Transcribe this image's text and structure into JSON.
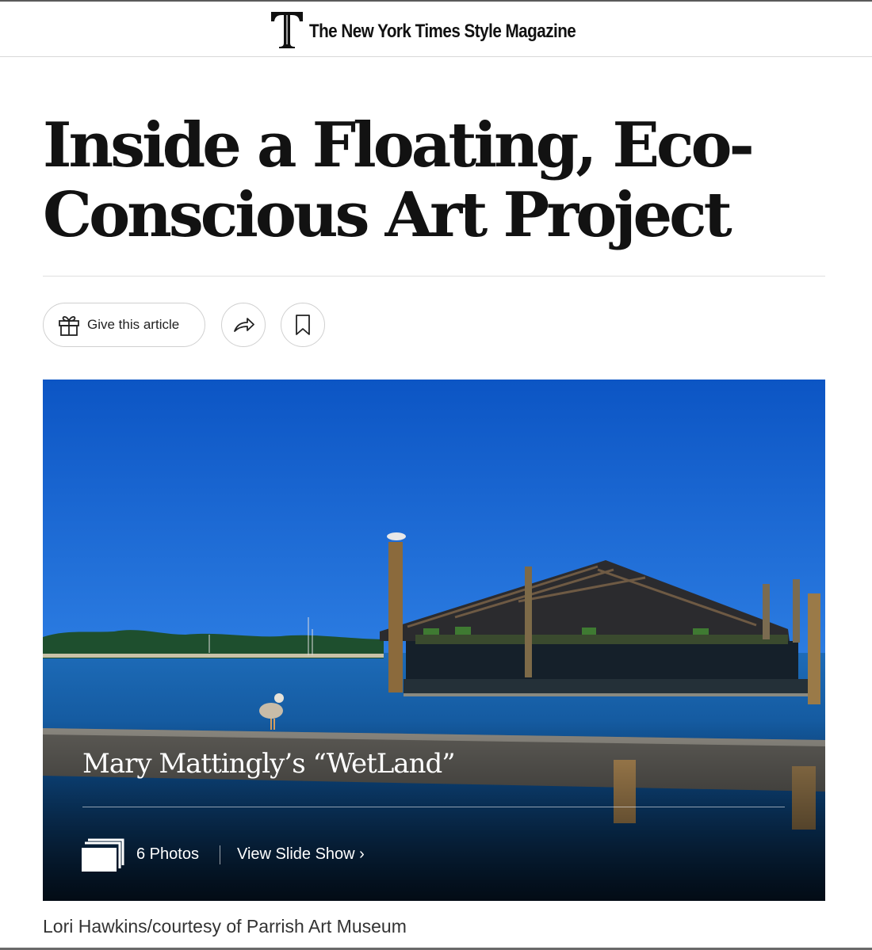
{
  "masthead": {
    "logo_letter": "T",
    "title": "The New York Times Style Magazine"
  },
  "article": {
    "headline_line1": "Inside a Floating, Eco-",
    "headline_line2": "Conscious Art Project"
  },
  "actions": {
    "give_label": "Give this article",
    "share_icon": "share-icon",
    "save_icon": "bookmark-icon"
  },
  "media": {
    "caption_title": "Mary Mattingly’s “WetLand”",
    "photo_count": "6 Photos",
    "view_label": "View Slide Show ›",
    "credit": "Lori Hawkins/courtesy of Parrish Art Museum"
  },
  "colors": {
    "sky": "#1462c7",
    "water": "#0f4f8c",
    "text": "#121212"
  }
}
